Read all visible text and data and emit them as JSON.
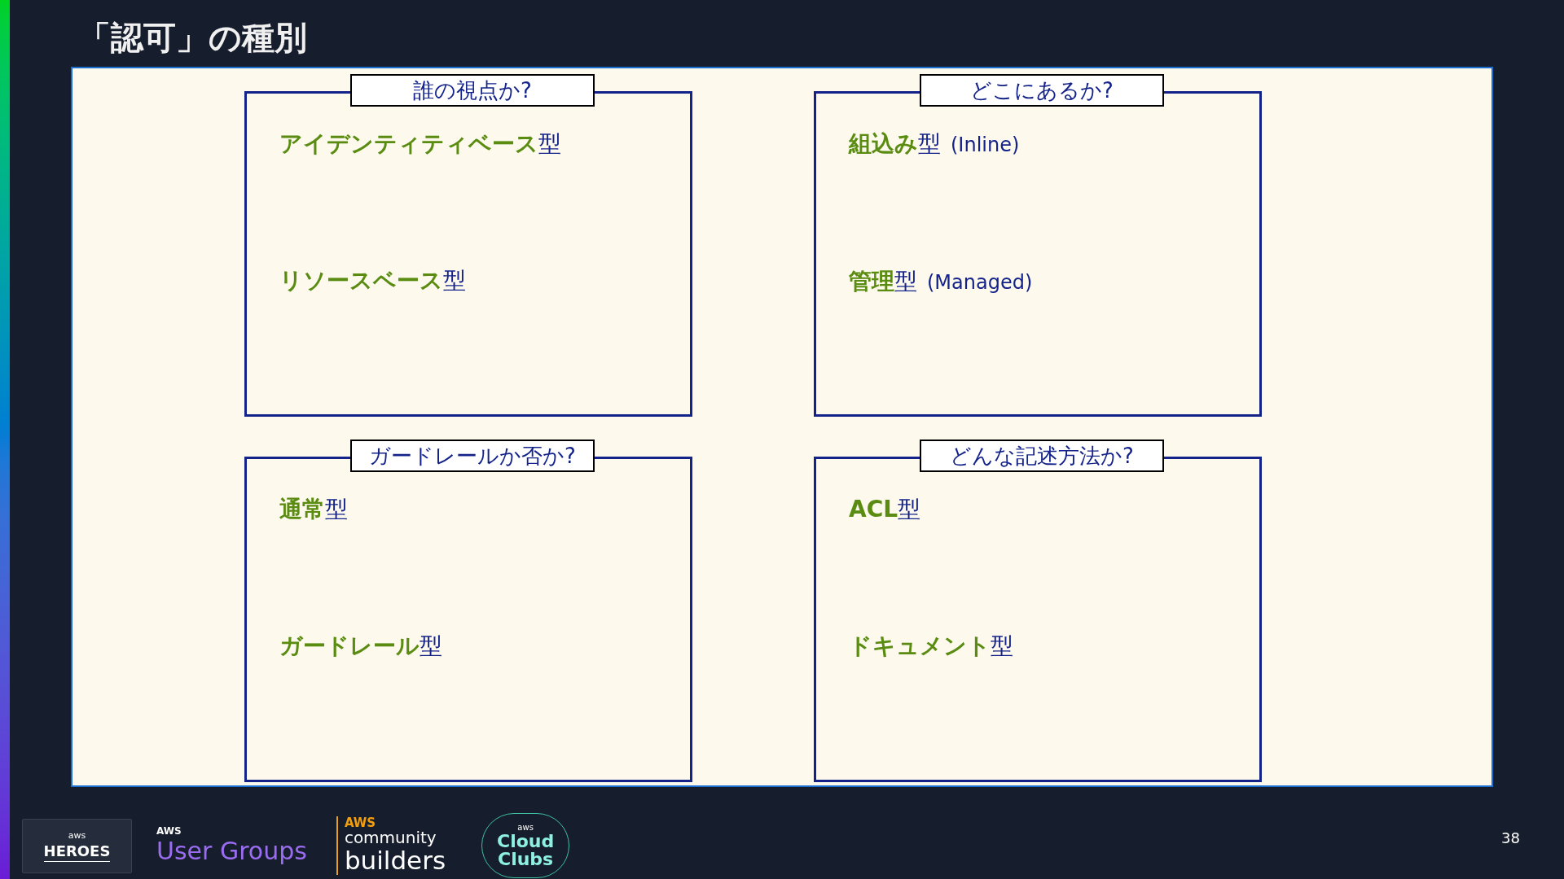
{
  "title": "「認可」の種別",
  "quadrants": [
    {
      "heading": "誰の視点か?",
      "items": [
        {
          "main": "アイデンティティベース",
          "suffix": "型"
        },
        {
          "main": "リソースベース",
          "suffix": "型"
        }
      ]
    },
    {
      "heading": "どこにあるか?",
      "items": [
        {
          "main": "組込み",
          "suffix": "型",
          "note": "(Inline)"
        },
        {
          "main": "管理",
          "suffix": "型",
          "note": "(Managed)"
        }
      ]
    },
    {
      "heading": "ガードレールか否か?",
      "items": [
        {
          "main": "通常",
          "suffix": "型"
        },
        {
          "main": "ガードレール",
          "suffix": "型"
        }
      ]
    },
    {
      "heading": "どんな記述方法か?",
      "items": [
        {
          "main": "ACL",
          "suffix": "型"
        },
        {
          "main": "ドキュメント",
          "suffix": "型"
        }
      ]
    }
  ],
  "footer": {
    "heroes": {
      "top": "aws",
      "name": "HEROES"
    },
    "user_groups": {
      "top": "AWS",
      "name": "User Groups"
    },
    "community_builders": {
      "top": "AWS",
      "middle": "community",
      "name": "builders"
    },
    "cloud_clubs": {
      "top": "aws",
      "line1": "Cloud",
      "line2": "Clubs"
    }
  },
  "page_number": "38"
}
